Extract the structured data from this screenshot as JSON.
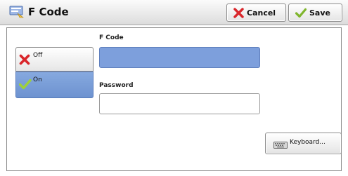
{
  "header": {
    "title": "F Code",
    "cancel_label": "Cancel",
    "save_label": "Save"
  },
  "options": {
    "off_label": "Off",
    "on_label": "On",
    "selected": "On"
  },
  "fields": {
    "fcode_label": "F Code",
    "fcode_value": "",
    "password_label": "Password",
    "password_value": ""
  },
  "keyboard_button_label": "Keyboard...",
  "colors": {
    "selected_blue": "#6d92d0",
    "cancel_red": "#d9262b",
    "save_green": "#7fb52c"
  }
}
